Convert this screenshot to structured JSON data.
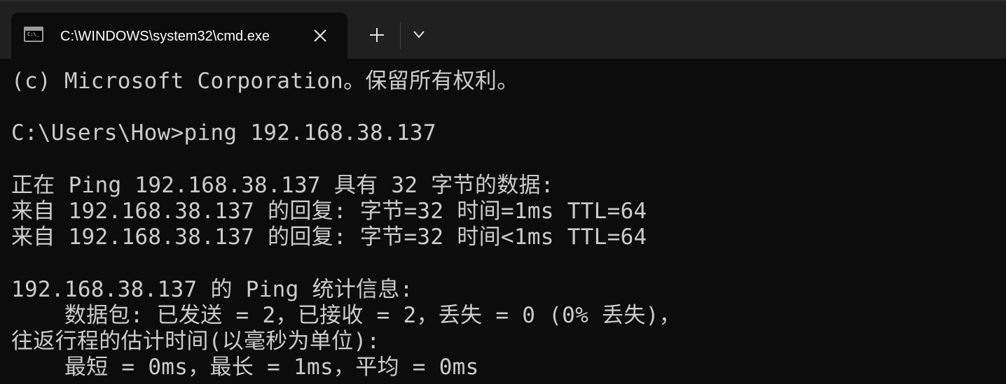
{
  "window": {
    "tab_title": "C:\\WINDOWS\\system32\\cmd.exe",
    "tab_icon": "terminal-icon",
    "close_icon": "close-icon",
    "new_tab_icon": "plus-icon",
    "dropdown_icon": "chevron-down-icon",
    "icon_prompt": "C:\\_"
  },
  "console": {
    "lines": [
      "(c) Microsoft Corporation。保留所有权利。",
      "",
      "C:\\Users\\How>ping 192.168.38.137",
      "",
      "正在 Ping 192.168.38.137 具有 32 字节的数据:",
      "来自 192.168.38.137 的回复: 字节=32 时间=1ms TTL=64",
      "来自 192.168.38.137 的回复: 字节=32 时间<1ms TTL=64",
      "",
      "192.168.38.137 的 Ping 统计信息:",
      "    数据包: 已发送 = 2，已接收 = 2，丢失 = 0 (0% 丢失)，",
      "往返行程的估计时间(以毫秒为单位):",
      "    最短 = 0ms，最长 = 1ms，平均 = 0ms"
    ]
  },
  "colors": {
    "background": "#0c0c0c",
    "titlebar": "#202020",
    "text": "#cccccc"
  }
}
